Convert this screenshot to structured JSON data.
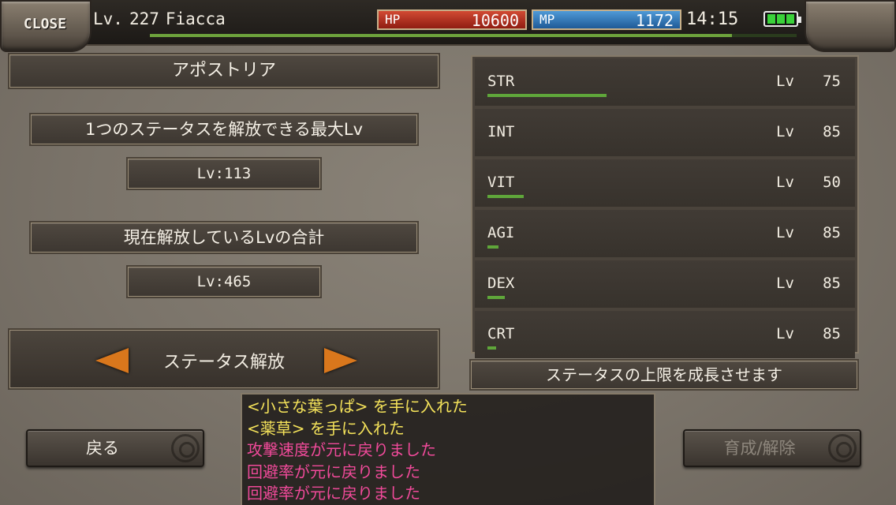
{
  "header": {
    "close_label": "CLOSE",
    "level_label": "Lv.",
    "level": "227",
    "player_name": "Fiacca",
    "exp_fraction": 0.9,
    "hp_label": "HP",
    "hp_value": "10600",
    "mp_label": "MP",
    "mp_value": "1172",
    "time": "14:15",
    "battery_cells": 3
  },
  "left_panel": {
    "title": "アポストリア",
    "max_level_heading": "1つのステータスを解放できる最大Lv",
    "max_level_value": "Lv:113",
    "total_level_heading": "現在解放しているLvの合計",
    "total_level_value": "Lv:465",
    "selector_label": "ステータス解放"
  },
  "stats": [
    {
      "name": "STR",
      "lv_label": "Lv",
      "value": "75",
      "progress_fraction": 0.56
    },
    {
      "name": "INT",
      "lv_label": "Lv",
      "value": "85",
      "progress_fraction": 0.0
    },
    {
      "name": "VIT",
      "lv_label": "Lv",
      "value": "50",
      "progress_fraction": 0.17
    },
    {
      "name": "AGI",
      "lv_label": "Lv",
      "value": "85",
      "progress_fraction": 0.05
    },
    {
      "name": "DEX",
      "lv_label": "Lv",
      "value": "85",
      "progress_fraction": 0.08
    },
    {
      "name": "CRT",
      "lv_label": "Lv",
      "value": "85",
      "progress_fraction": 0.04
    }
  ],
  "stat_description": "ステータスの上限を成長させます",
  "buttons": {
    "back_label": "戻る",
    "train_label": "育成/解除"
  },
  "log": [
    {
      "text": "<小さな葉っぱ> を手に入れた",
      "color": "yellow"
    },
    {
      "text": "<薬草> を手に入れた",
      "color": "yellow"
    },
    {
      "text": "攻撃速度が元に戻りました",
      "color": "pink"
    },
    {
      "text": "回避率が元に戻りました",
      "color": "pink"
    },
    {
      "text": "回避率が元に戻りました",
      "color": "pink"
    }
  ],
  "colors": {
    "hp": "#b8301f",
    "mp": "#2f74b8",
    "progress": "#5fa63a",
    "arrow": "#d9771c",
    "log_yellow": "#f4e25a",
    "log_pink": "#f04a9a"
  }
}
